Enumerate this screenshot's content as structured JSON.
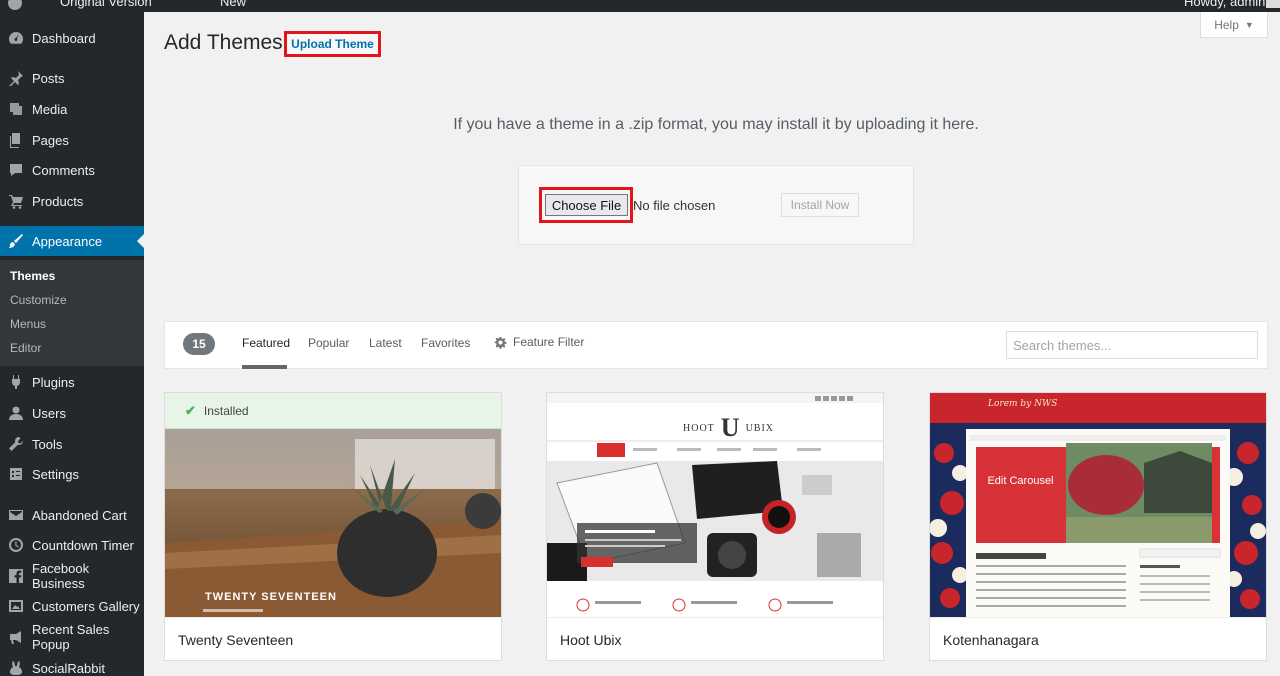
{
  "admin_bar": {
    "site_name": "Original Version",
    "new_label": "New",
    "greeting": "Howdy, admin"
  },
  "sidebar": {
    "items": [
      {
        "label": "Dashboard",
        "icon": "dashboard-icon"
      },
      {
        "label": "Posts",
        "icon": "pushpin-icon"
      },
      {
        "label": "Media",
        "icon": "media-icon"
      },
      {
        "label": "Pages",
        "icon": "pages-icon"
      },
      {
        "label": "Comments",
        "icon": "comment-icon"
      },
      {
        "label": "Products",
        "icon": "cart-icon"
      },
      {
        "label": "Appearance",
        "icon": "paintbrush-icon"
      },
      {
        "label": "Plugins",
        "icon": "plug-icon"
      },
      {
        "label": "Users",
        "icon": "user-icon"
      },
      {
        "label": "Tools",
        "icon": "wrench-icon"
      },
      {
        "label": "Settings",
        "icon": "settings-icon"
      },
      {
        "label": "Abandoned Cart",
        "icon": "email-icon"
      },
      {
        "label": "Countdown Timer",
        "icon": "clock-icon"
      },
      {
        "label": "Facebook Business",
        "icon": "facebook-icon"
      },
      {
        "label": "Customers Gallery",
        "icon": "gallery-icon"
      },
      {
        "label": "Recent Sales Popup",
        "icon": "megaphone-icon"
      },
      {
        "label": "SocialRabbit",
        "icon": "rabbit-icon"
      }
    ],
    "active": "Appearance",
    "submenu": [
      "Themes",
      "Customize",
      "Menus",
      "Editor"
    ],
    "submenu_current": "Themes"
  },
  "header": {
    "title": "Add Themes",
    "upload_button": "Upload Theme",
    "help_label": "Help"
  },
  "upload": {
    "description": "If you have a theme in a .zip format, you may install it by uploading it here.",
    "choose_file": "Choose File",
    "no_file": "No file chosen",
    "install_now": "Install Now"
  },
  "filter": {
    "count": "15",
    "tabs": [
      "Featured",
      "Popular",
      "Latest",
      "Favorites"
    ],
    "current_tab": "Featured",
    "feature_filter": "Feature Filter",
    "search_placeholder": "Search themes..."
  },
  "themes": [
    {
      "name": "Twenty Seventeen",
      "installed_label": "Installed",
      "screenshot_title": "TWENTY SEVENTEEN"
    },
    {
      "name": "Hoot Ubix",
      "screenshot_logo": "U"
    },
    {
      "name": "Kotenhanagara",
      "screenshot_carousel": "Edit Carousel",
      "screenshot_heading": "Lorem by NWS"
    }
  ],
  "colors": {
    "sidebar_bg": "#23282d",
    "active_bg": "#0073aa",
    "highlight_border": "#e0161b",
    "installed_check": "#46b450"
  }
}
